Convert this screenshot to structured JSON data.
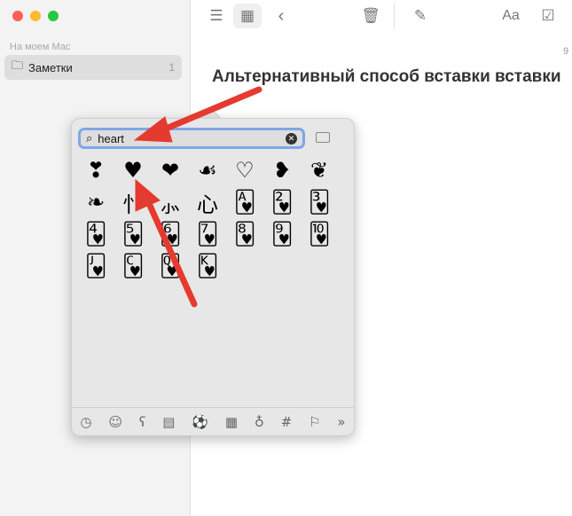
{
  "sidebar": {
    "section": "На моем Mac",
    "folder": {
      "label": "Заметки",
      "count": "1"
    }
  },
  "toolbar": {
    "icons": [
      "list-icon",
      "grid-icon",
      "back-icon",
      "trash-icon",
      "compose-icon",
      "format-icon",
      "checklist-icon"
    ],
    "format_label": "Aa"
  },
  "note": {
    "date": "9",
    "title": "Альтернативный способ вставки вставки"
  },
  "picker": {
    "search_value": "heart",
    "results": [
      "❣",
      "♥",
      "❤",
      "☙",
      "♡",
      "❥",
      "❦",
      "❧",
      "忄",
      "⺗",
      "心",
      "🂱",
      "🂲",
      "🂳",
      "🂴",
      "🂵",
      "🂶",
      "🂷",
      "🂸",
      "🂹",
      "🂺",
      "🂻",
      "🂼",
      "🂽",
      "🂾"
    ],
    "categories": [
      "◷",
      "☺",
      "ʕ",
      "▤",
      "⚽",
      "▦",
      "♁",
      "#",
      "⚐",
      "»"
    ]
  },
  "colors": {
    "arrow": "#e53a2f",
    "search_focus": "#7fa6e6"
  }
}
